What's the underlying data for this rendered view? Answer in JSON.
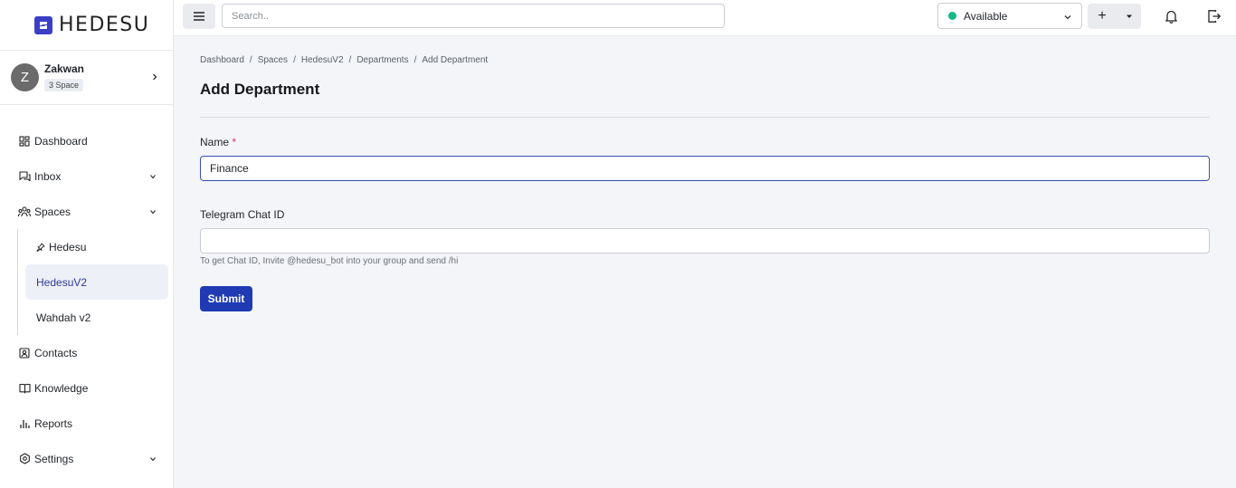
{
  "app": {
    "logo_text": "HEDESU",
    "accent_color": "#1f3ab3",
    "logo_color": "#3b3fc7"
  },
  "user": {
    "initial": "Z",
    "name": "Zakwan",
    "badge": "3 Space"
  },
  "sidebar": {
    "items": [
      {
        "label": "Dashboard",
        "icon": "dashboard-icon"
      },
      {
        "label": "Inbox",
        "icon": "inbox-icon",
        "expandable": true
      },
      {
        "label": "Spaces",
        "icon": "spaces-icon",
        "expandable": true,
        "expanded": true
      },
      {
        "label": "Contacts",
        "icon": "contacts-icon"
      },
      {
        "label": "Knowledge",
        "icon": "knowledge-icon"
      },
      {
        "label": "Reports",
        "icon": "reports-icon"
      },
      {
        "label": "Settings",
        "icon": "settings-icon",
        "expandable": true
      }
    ],
    "spaces": [
      {
        "label": "Hedesu",
        "pinned": true
      },
      {
        "label": "HedesuV2",
        "active": true
      },
      {
        "label": "Wahdah v2"
      }
    ]
  },
  "topbar": {
    "search_placeholder": "Search..",
    "status_label": "Available",
    "status_color": "#12b886",
    "add_label": "+"
  },
  "breadcrumb": [
    "Dashboard",
    "Spaces",
    "HedesuV2",
    "Departments",
    "Add Department"
  ],
  "page": {
    "title": "Add Department",
    "form": {
      "name_label": "Name",
      "name_required": "*",
      "name_value": "Finance",
      "telegram_label": "Telegram Chat ID",
      "telegram_value": "",
      "telegram_help": "To get Chat ID, Invite @hedesu_bot into your group and send /hi",
      "submit_label": "Submit"
    }
  }
}
